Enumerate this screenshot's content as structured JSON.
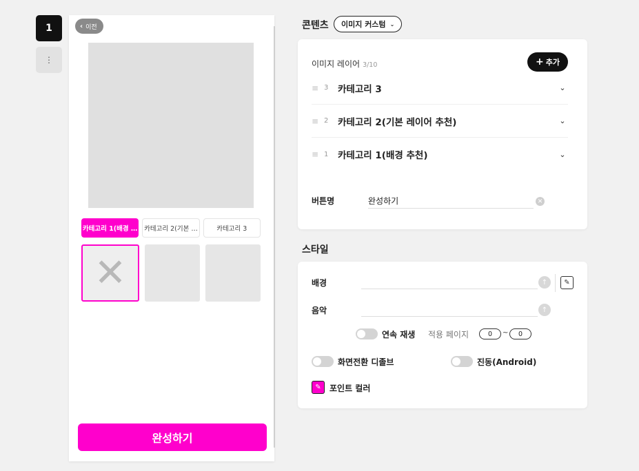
{
  "rail": {
    "page_number": "1",
    "more_icon": "more-vertical-icon"
  },
  "preview": {
    "back_label": "이전",
    "tabs": [
      "카테고리 1(배경 …",
      "카테고리 2(기본 …",
      "카테고리 3"
    ],
    "active_tab_index": 0,
    "complete_button": "완성하기",
    "accent_color": "#ff00cc"
  },
  "content": {
    "section_title": "콘텐츠",
    "dropdown_value": "이미지 커스텀",
    "layer_title": "이미지 레이어",
    "layer_count": "3/10",
    "add_button": "추가",
    "layers": [
      {
        "index": "3",
        "name": "카테고리 3"
      },
      {
        "index": "2",
        "name": "카테고리 2(기본 레이어 추천)"
      },
      {
        "index": "1",
        "name": "카테고리 1(배경 추천)"
      }
    ],
    "button_name_label": "버튼명",
    "button_name_value": "완성하기"
  },
  "style": {
    "section_title": "스타일",
    "background_label": "배경",
    "music_label": "음악",
    "continuous_play_label": "연속 재생",
    "page_range_label": "적용 페이지",
    "range_from": "0",
    "range_to": "0",
    "dissolve_label": "화면전환 디졸브",
    "vibration_label": "진동(Android)",
    "point_color_label": "포인트 컬러",
    "point_color": "#ff00cc"
  }
}
